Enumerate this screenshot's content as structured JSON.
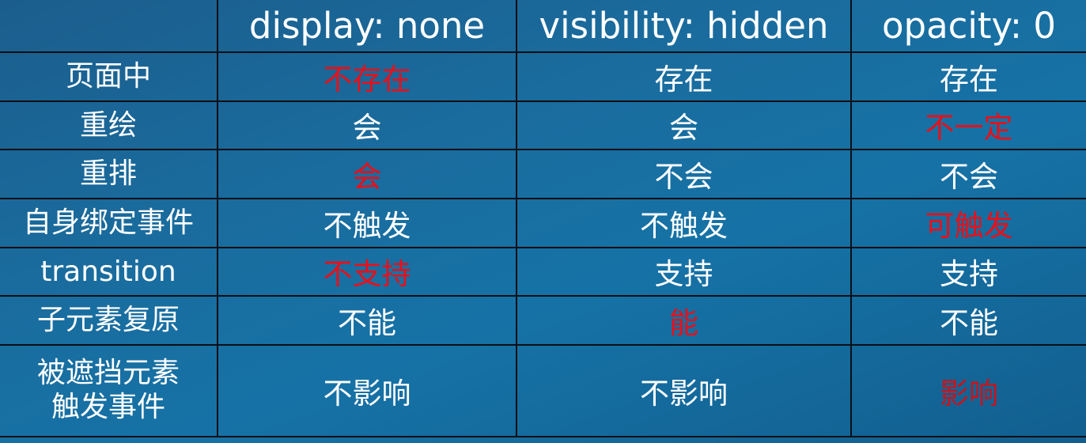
{
  "columns": [
    "",
    "display: none",
    "visibility: hidden",
    "opacity: 0"
  ],
  "rows": [
    {
      "label": "页面中",
      "cells": [
        "不存在",
        "存在",
        "存在"
      ],
      "highlight": [
        true,
        false,
        false
      ]
    },
    {
      "label": "重绘",
      "cells": [
        "会",
        "会",
        "不一定"
      ],
      "highlight": [
        false,
        false,
        true
      ]
    },
    {
      "label": "重排",
      "cells": [
        "会",
        "不会",
        "不会"
      ],
      "highlight": [
        true,
        false,
        false
      ]
    },
    {
      "label": "自身绑定事件",
      "cells": [
        "不触发",
        "不触发",
        "可触发"
      ],
      "highlight": [
        false,
        false,
        true
      ]
    },
    {
      "label": "transition",
      "cells": [
        "不支持",
        "支持",
        "支持"
      ],
      "highlight": [
        true,
        false,
        false
      ]
    },
    {
      "label": "子元素复原",
      "cells": [
        "不能",
        "能",
        "不能"
      ],
      "highlight": [
        false,
        true,
        false
      ]
    },
    {
      "label_lines": [
        "被遮挡元素",
        "触发事件"
      ],
      "cells": [
        "不影响",
        "不影响",
        "影响"
      ],
      "highlight": [
        false,
        false,
        true
      ]
    }
  ],
  "colors": {
    "header_text": "#f3ee3c",
    "body_text": "#ffffff",
    "highlight_text": "#e8101a",
    "grid_lines": "#0b0f14",
    "background": "#1a6c9e"
  }
}
